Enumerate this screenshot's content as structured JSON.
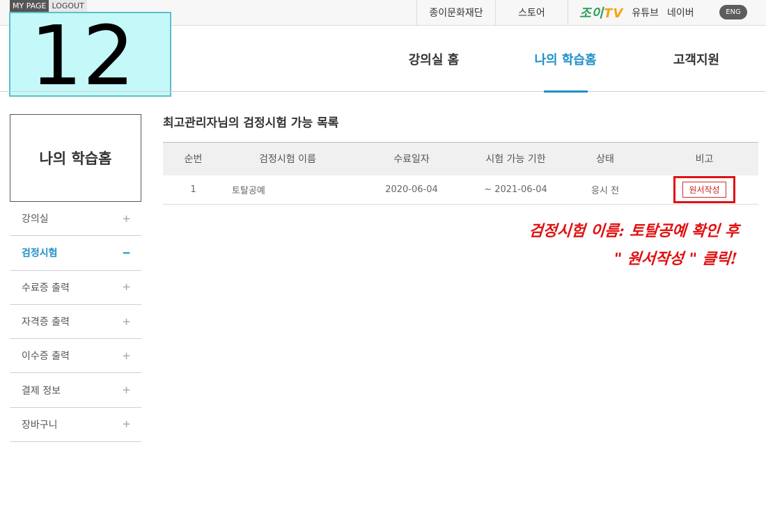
{
  "topbar": {
    "mypage": "MY PAGE",
    "logout": "LOGOUT",
    "links": [
      "종이문화재단",
      "스토어"
    ],
    "tv_logo": {
      "part1": "조이",
      "part2": "TV"
    },
    "tv_links": [
      "유튜브",
      "네이버"
    ],
    "lang": "ENG"
  },
  "badge": {
    "number": "12"
  },
  "mainnav": {
    "tabs": [
      "강의실 홈",
      "나의 학습홈",
      "고객지원"
    ],
    "active_tab": "나의 학습홈"
  },
  "sidebar": {
    "title": "나의 학습홈",
    "items": [
      {
        "label": "강의실",
        "sign": "+"
      },
      {
        "label": "검정시험",
        "sign": "−"
      },
      {
        "label": "수료증 출력",
        "sign": "+"
      },
      {
        "label": "자격증 출력",
        "sign": "+"
      },
      {
        "label": "이수증 출력",
        "sign": "+"
      },
      {
        "label": "결제 정보",
        "sign": "+"
      },
      {
        "label": "장바구니",
        "sign": "+"
      }
    ],
    "active_item": "검정시험"
  },
  "content": {
    "title": "최고관리자님의 검정시험 가능 목록",
    "columns": [
      "순번",
      "검정시험 이름",
      "수료일자",
      "시험 가능 기한",
      "상태",
      "비고"
    ],
    "rows": [
      {
        "no": "1",
        "name": "토탈공예",
        "completed": "2020-06-04",
        "deadline": "~ 2021-06-04",
        "status": "응시 전",
        "action": "원서작성"
      }
    ]
  },
  "annotation": {
    "line1": "검정시험 이름: 토탈공예 확인 후",
    "line2": "\" 원서작성 \" 클릭!"
  },
  "colors": {
    "accent": "#1e90c8",
    "highlight": "#e01010",
    "badge_bg": "#c4f8f9"
  }
}
